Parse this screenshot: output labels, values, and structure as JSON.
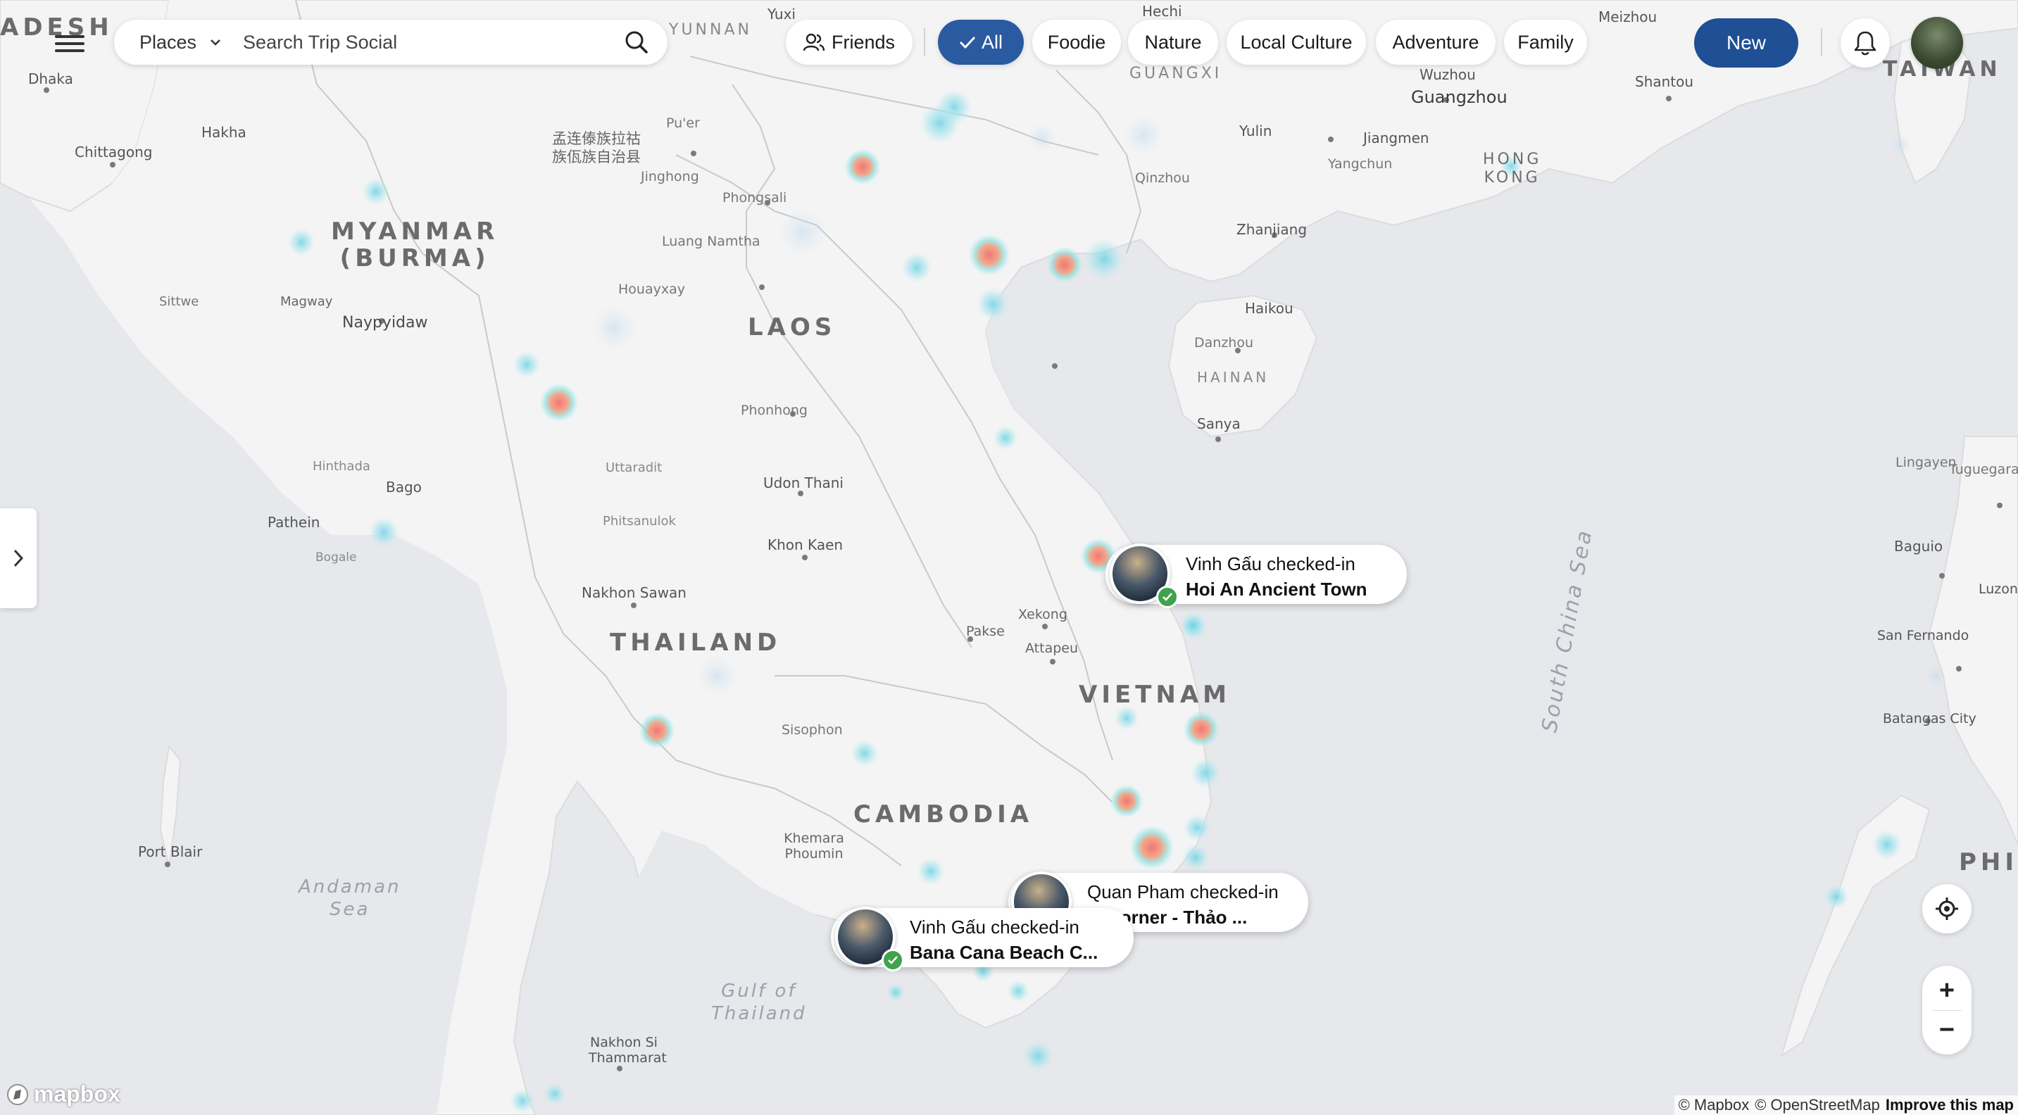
{
  "top_bar": {
    "places_label": "Places",
    "search_placeholder": "Search Trip Social",
    "friends_label": "Friends",
    "filters": [
      "All",
      "Foodie",
      "Nature",
      "Local Culture",
      "Adventure",
      "Family"
    ],
    "active_filter": "All",
    "new_label": "New"
  },
  "map": {
    "countries": [
      "ADESH",
      "MYANMAR",
      "(BURMA)",
      "LAOS",
      "THAILAND",
      "VIETNAM",
      "CAMBODIA",
      "TAIWAN",
      "PHIL"
    ],
    "cities": [
      "Dhaka",
      "Chittagong",
      "Hakha",
      "Sittwe",
      "Magway",
      "Naypyidaw",
      "Bago",
      "Pathein",
      "Hinthada",
      "Bogale",
      "Port Blair",
      "Nakhon Si Thammarat",
      "Jinghong",
      "Pu'er",
      "Luang Namtha",
      "Phongsali",
      "Houayxay",
      "Phonhong",
      "Uttaradit",
      "Phitsanulok",
      "Udon Thani",
      "Khon Kaen",
      "Nakhon Sawan",
      "Pakse",
      "Xekong",
      "Attapeu",
      "Sisophon",
      "Khemara Phoumin",
      "Hechi",
      "Yuxi",
      "Meizhou",
      "Shantou",
      "Wuzhou",
      "Guangzhou",
      "Yulin",
      "Jiangmen",
      "Yangchun",
      "Qinzhou",
      "Zhanjiang",
      "Haikou",
      "Danzhou",
      "Sanya",
      "Lingayen",
      "Tuguegarao",
      "Baguio",
      "San Fernando",
      "Luzon",
      "Batangas City"
    ],
    "regions": [
      "YUNNAN",
      "GUANGXI",
      "HAINAN"
    ],
    "hk_label": [
      "HONG",
      "KONG"
    ],
    "chinese_label": [
      "孟连傣族拉祜",
      "族佤族自治县"
    ],
    "seas": [
      "Andaman",
      "Sea",
      "Gulf of",
      "Thailand",
      "South China Sea"
    ]
  },
  "checkins": [
    {
      "line1": "Vinh Gấu checked-in",
      "line2": "Hoi An Ancient Town"
    },
    {
      "line1": "Quan Pham checked-in",
      "line2": "Corner - Thảo ..."
    },
    {
      "line1": "Vinh Gấu checked-in",
      "line2": "Bana Cana Beach C..."
    }
  ],
  "controls": {
    "zoom_in": "+",
    "zoom_out": "−"
  },
  "footer": {
    "logo_text": "mapbox",
    "attribution_1": "© Mapbox",
    "attribution_2": "© OpenStreetMap",
    "improve": "Improve this map"
  },
  "colors": {
    "accent": "#2a5aa0",
    "new_button": "#1f4f94",
    "heat_hot": "#f07a7a",
    "heat_cool": "#7fd4e0",
    "check": "#3fa34d"
  }
}
